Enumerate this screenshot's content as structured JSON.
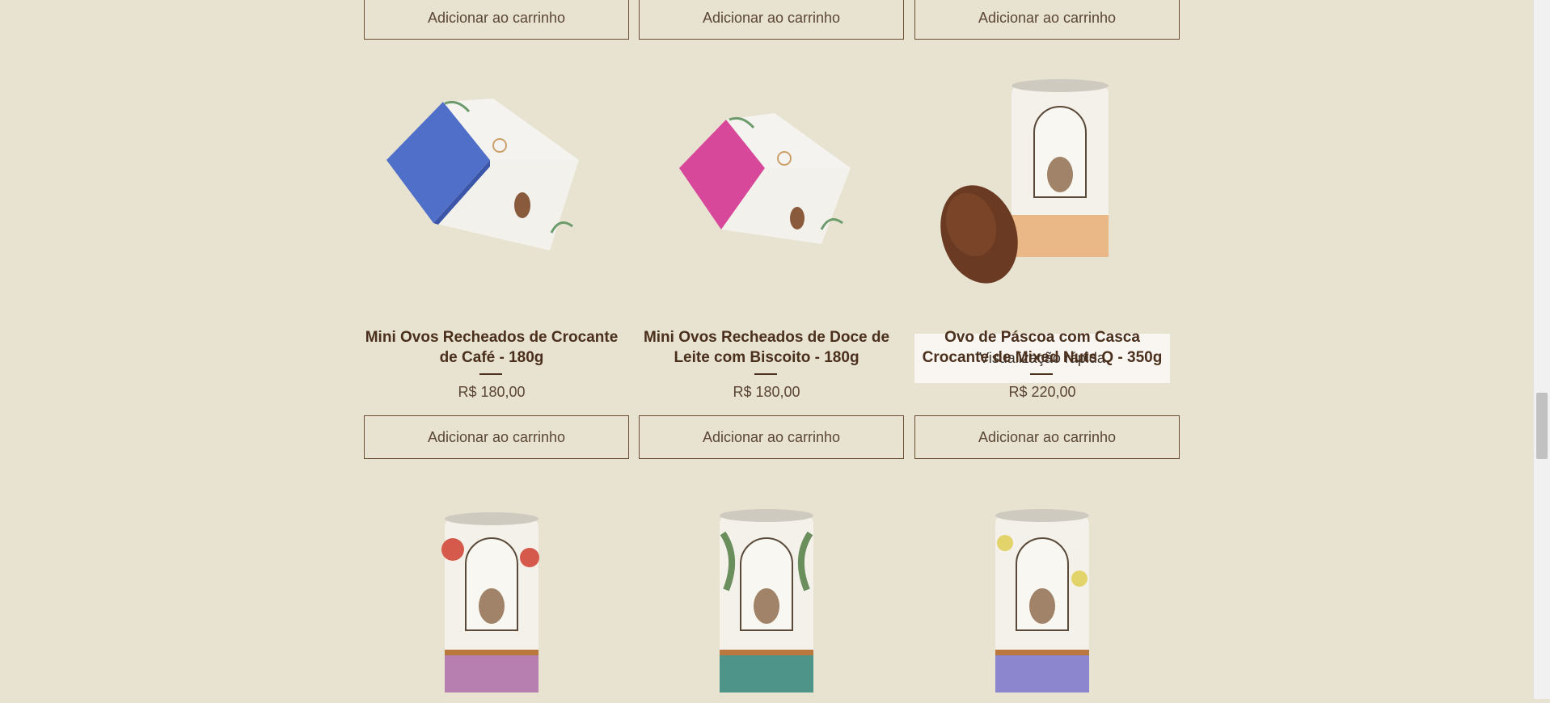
{
  "add_to_cart_label": "Adicionar ao carrinho",
  "quick_view_label": "Visualização rápida",
  "products": [
    {
      "title": "Mini Ovos Recheados de Crocante de Café - 180g",
      "price": "R$ 180,00",
      "box_color": "#4f6fc9"
    },
    {
      "title": "Mini Ovos Recheados de Doce de Leite com Biscoito - 180g",
      "price": "R$ 180,00",
      "box_color": "#d8489a"
    },
    {
      "title": "Ovo de Páscoa com Casca Crocante de Mixed Nuts Q - 350g",
      "price": "R$ 220,00",
      "can_band_color": "#e9b886"
    }
  ],
  "bottom_row": [
    {
      "band_color": "#b77fb0",
      "flower_color": "#d65a4b"
    },
    {
      "band_color": "#4f9488",
      "flower_color": "#6a8f5d"
    },
    {
      "band_color": "#8c86cf",
      "flower_color": "#e3d36b"
    }
  ]
}
